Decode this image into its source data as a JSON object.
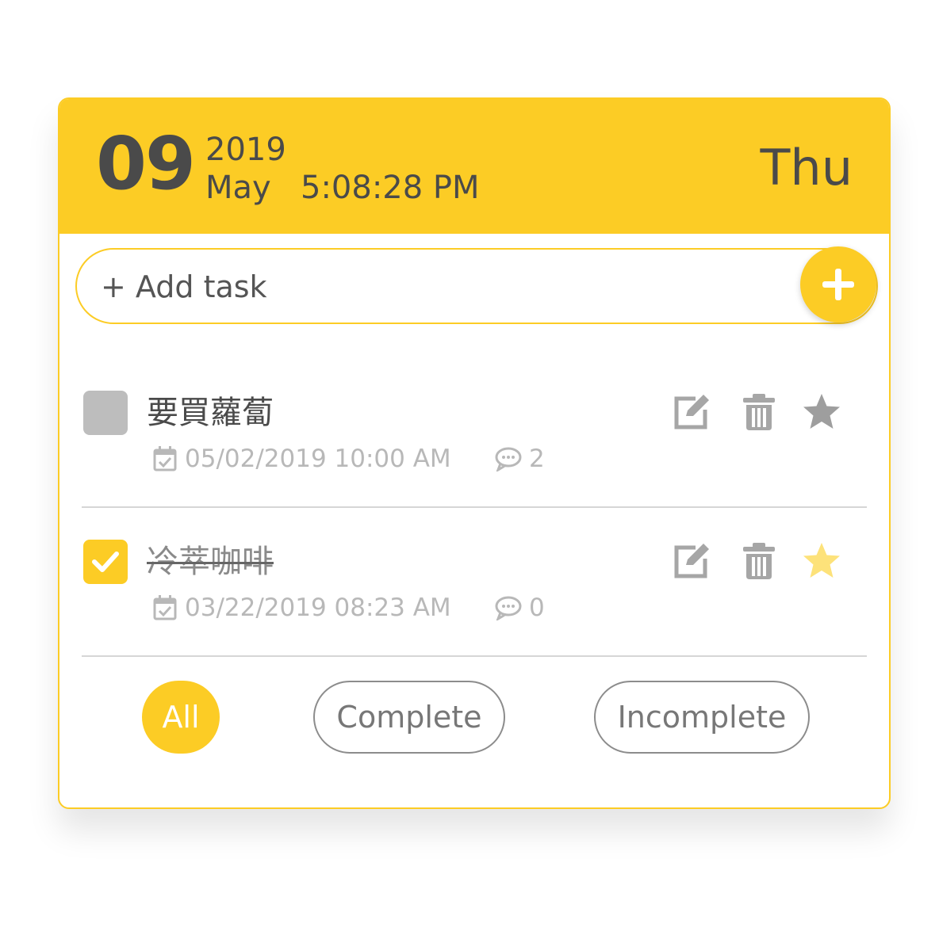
{
  "header": {
    "day": "09",
    "year": "2019",
    "month": "May",
    "time": "5:08:28 PM",
    "weekday": "Thu"
  },
  "add_task": {
    "placeholder": "+ Add task",
    "button_icon": "plus-icon"
  },
  "tasks": [
    {
      "title": "要買蘿蔔",
      "completed": false,
      "date": "05/02/2019 10:00 AM",
      "comments": "2",
      "starred": false
    },
    {
      "title": "冷萃咖啡",
      "completed": true,
      "date": "03/22/2019 08:23 AM",
      "comments": "0",
      "starred": true
    }
  ],
  "filters": {
    "all": "All",
    "complete": "Complete",
    "incomplete": "Incomplete",
    "active": "all"
  },
  "colors": {
    "accent": "#fccc25",
    "text": "#4a4a4a",
    "muted": "#b8b8b8",
    "unchecked": "#bdbdbd",
    "star_inactive": "#9e9e9e",
    "star_active": "#fde27a"
  }
}
